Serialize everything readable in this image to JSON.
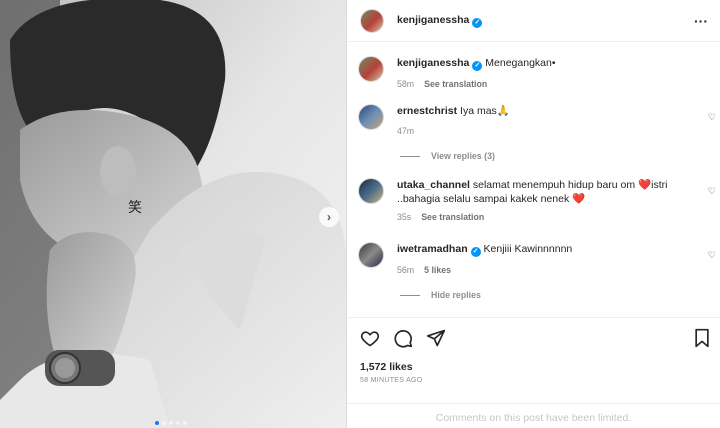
{
  "post": {
    "username": "kenjiganessha",
    "carousel": {
      "total_slides": 5,
      "active_slide": 1
    }
  },
  "caption": {
    "username": "kenjiganessha",
    "text": "Menegangkan•",
    "time": "58m",
    "see_translation": "See translation"
  },
  "comments": [
    {
      "username": "ernestchrist",
      "text": "Iya mas🙏",
      "time": "47m",
      "view_replies": "View replies (3)"
    },
    {
      "username": "utaka_channel",
      "text": "selamat menempuh hidup baru om ❤️istri ..bahagia selalu sampai kakek nenek ❤️",
      "time": "35s",
      "see_translation": "See translation"
    },
    {
      "username": "iwetramadhan",
      "text": "Kenjiii Kawinnnnnn",
      "time": "56m",
      "likes": "5 likes",
      "hide_replies": "Hide replies"
    }
  ],
  "stats": {
    "likes": "1,572 likes",
    "time_ago": "58 MINUTES AGO"
  },
  "footer": {
    "limited_notice": "Comments on this post have been limited."
  },
  "colors": {
    "verified": "#0095f6",
    "carousel_active_dot": "#1877f2",
    "muted_text": "#8e8e8e",
    "heart": "#c9302c"
  },
  "icons": [
    "more-icon",
    "verified-icon",
    "heart-icon",
    "comment-icon",
    "share-icon",
    "bookmark-icon",
    "chevron-right-icon"
  ]
}
